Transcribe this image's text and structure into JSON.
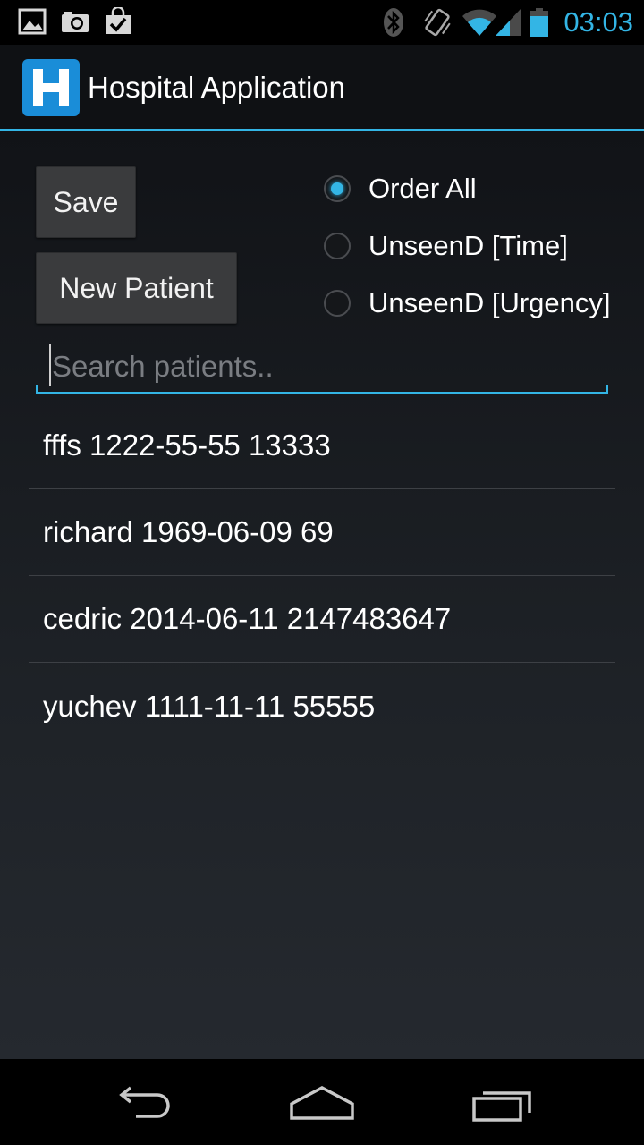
{
  "status_bar": {
    "time": "03:03",
    "icons": [
      "gallery-icon",
      "camera-icon",
      "shopping-bag-check-icon",
      "bluetooth-icon",
      "vibrate-icon",
      "wifi-icon",
      "signal-icon",
      "battery-icon"
    ],
    "accent_color": "#33b5e5"
  },
  "action_bar": {
    "logo_letter": "H",
    "title": "Hospital Application"
  },
  "controls": {
    "save_label": "Save",
    "new_patient_label": "New Patient",
    "sort_options": [
      {
        "label": "Order All",
        "checked": true
      },
      {
        "label": "UnseenD [Time]",
        "checked": false
      },
      {
        "label": "UnseenD [Urgency]",
        "checked": false
      }
    ]
  },
  "search": {
    "value": "",
    "placeholder": "Search patients.."
  },
  "patients": [
    {
      "text": "fffs 1222-55-55 13333"
    },
    {
      "text": "richard 1969-06-09 69"
    },
    {
      "text": "cedric 2014-06-11 2147483647"
    },
    {
      "text": "yuchev 1111-11-11 55555"
    }
  ],
  "nav_bar": {
    "icons": [
      "back-icon",
      "home-icon",
      "recent-apps-icon"
    ]
  }
}
